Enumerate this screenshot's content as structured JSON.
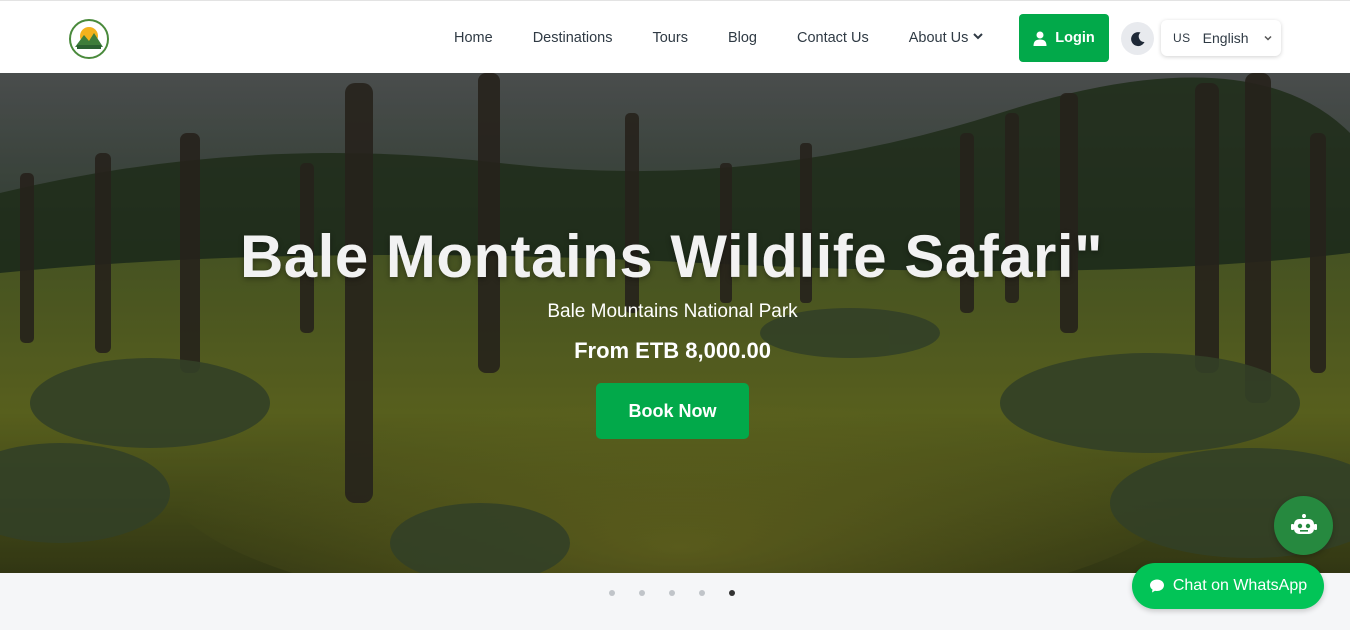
{
  "header": {
    "logo_icon": "mountain-logo-icon",
    "nav": [
      {
        "label": "Home"
      },
      {
        "label": "Destinations"
      },
      {
        "label": "Tours"
      },
      {
        "label": "Blog"
      },
      {
        "label": "Contact Us"
      },
      {
        "label": "About Us"
      }
    ],
    "login_label": "Login",
    "theme_icon": "moon-icon",
    "language": {
      "flag": "US",
      "selected": "English"
    }
  },
  "hero": {
    "title": "Bale Montains Wildlife Safari\"",
    "subtitle": "Bale Mountains National Park",
    "price": "From ETB 8,000.00",
    "cta_label": "Book Now"
  },
  "carousel": {
    "count": 5,
    "active_index": 4
  },
  "floating": {
    "chatbot_icon": "robot-icon",
    "whatsapp_label": "Chat on WhatsApp"
  },
  "colors": {
    "accent": "#02a94a",
    "whatsapp": "#02c457",
    "chatbot": "#26893f"
  }
}
